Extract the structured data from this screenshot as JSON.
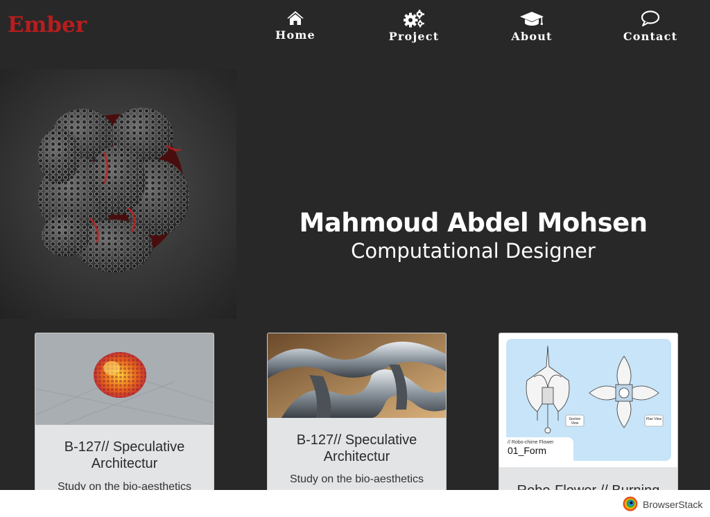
{
  "brand": {
    "logo": "Ember"
  },
  "nav": {
    "items": [
      {
        "label": "Home",
        "icon": "home-icon"
      },
      {
        "label": "Project",
        "icon": "gears-icon"
      },
      {
        "label": "About",
        "icon": "graduation-cap-icon"
      },
      {
        "label": "Contact",
        "icon": "speech-bubble-icon"
      }
    ]
  },
  "hero": {
    "name": "Mahmoud Abdel Mohsen",
    "role": "Computational Designer"
  },
  "cards": [
    {
      "title": "B-127// Speculative Architectur",
      "desc": "Study on the bio-aesthetics"
    },
    {
      "title": "B-127// Speculative Architectur",
      "desc": "Study on the bio-aesthetics"
    },
    {
      "title": "Robo-Flower // Burning",
      "image_caption_small": "// Robo-chime Flower",
      "image_caption_large": "01_Form",
      "section_label": "Section View",
      "plan_label": "Plan View"
    }
  ],
  "footer": {
    "brand": "BrowserStack"
  },
  "colors": {
    "background": "#282828",
    "logo": "#b81d1d",
    "card": "#e3e4e6",
    "diagram_bg": "#c8e4f8"
  }
}
